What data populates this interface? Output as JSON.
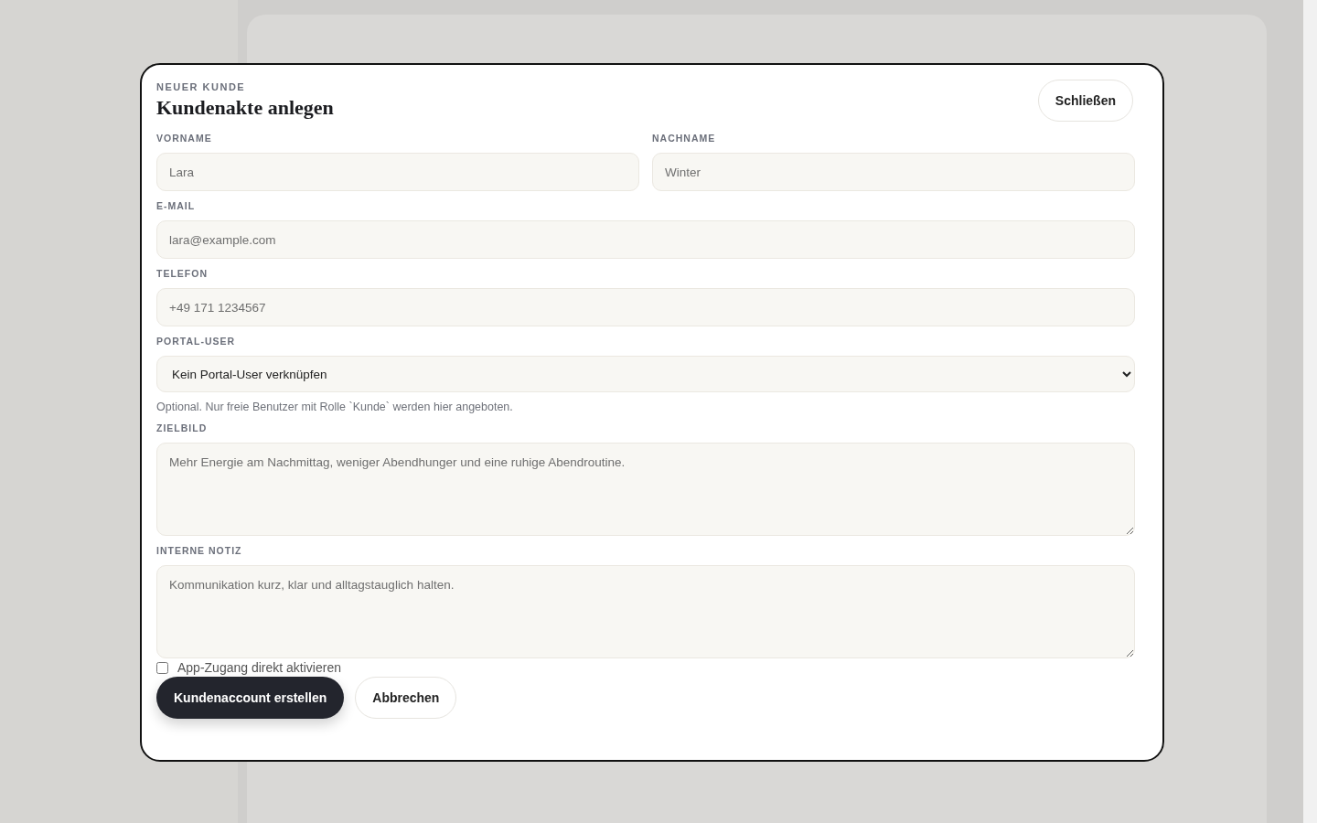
{
  "dialog": {
    "eyebrow": "NEUER KUNDE",
    "title": "Kundenakte anlegen",
    "close_button": "Schließen",
    "name_row": [
      {
        "kind": "input",
        "label": "VORNAME",
        "placeholder": "Lara"
      },
      {
        "kind": "input",
        "label": "NACHNAME",
        "placeholder": "Winter"
      }
    ],
    "fields": [
      {
        "kind": "input",
        "label": "E-MAIL",
        "placeholder": "lara@example.com"
      },
      {
        "kind": "input",
        "label": "TELEFON",
        "placeholder": "+49 171 1234567"
      },
      {
        "kind": "select",
        "label": "PORTAL-USER",
        "value": "Kein Portal-User verknüpfen",
        "hint": "Optional. Nur freie Benutzer mit Rolle `Kunde` werden hier angeboten."
      },
      {
        "kind": "textarea",
        "label": "ZIELBILD",
        "placeholder": "Mehr Energie am Nachmittag, weniger Abendhunger und eine ruhige Abendroutine."
      },
      {
        "kind": "textarea",
        "label": "INTERNE NOTIZ",
        "placeholder": "Kommunikation kurz, klar und alltagstauglich halten."
      }
    ],
    "checkbox": {
      "label": "App-Zugang direkt aktivieren",
      "checked": false
    },
    "primary_button": "Kundenaccount erstellen",
    "secondary_button": "Abbrechen"
  }
}
